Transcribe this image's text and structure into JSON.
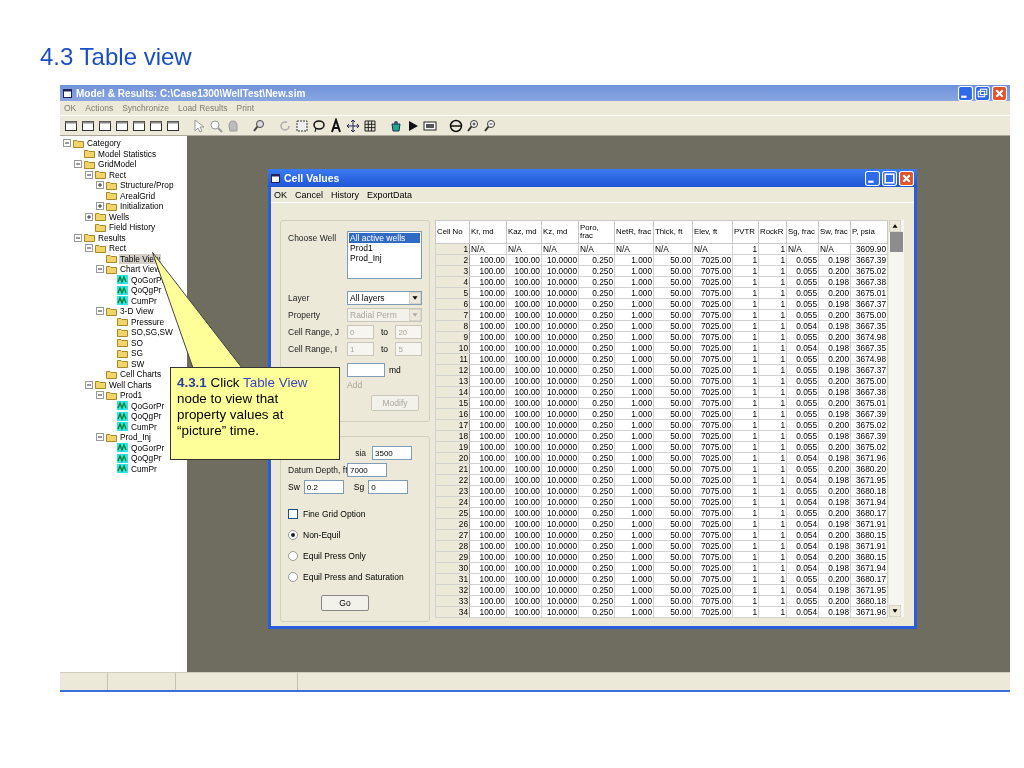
{
  "slide_title": "4.3 Table view",
  "window": {
    "title": "Model & Results:  C:\\Case1300\\WellTest\\New.sim"
  },
  "menu": [
    {
      "label": "OK",
      "disabled": true
    },
    {
      "label": "Actions",
      "disabled": true
    },
    {
      "label": "Synchronize",
      "disabled": true
    },
    {
      "label": "Load Results",
      "disabled": true
    },
    {
      "label": "Print",
      "disabled": true
    }
  ],
  "tree": [
    {
      "label": "Category",
      "kind": "folder",
      "expanded": true,
      "selected": false,
      "children": [
        {
          "label": "Model Statistics",
          "kind": "folder",
          "selected": false
        },
        {
          "label": "GridModel",
          "kind": "folder",
          "expanded": true,
          "selected": false,
          "children": [
            {
              "label": "Rect",
              "kind": "folder",
              "expanded": true,
              "selected": false,
              "children": [
                {
                  "label": "Structure/Prop",
                  "kind": "folder",
                  "expanded": false,
                  "selected": false
                },
                {
                  "label": "ArealGrid",
                  "kind": "folder",
                  "selected": false
                },
                {
                  "label": "Initialization",
                  "kind": "folder",
                  "expanded": false,
                  "selected": false
                }
              ]
            },
            {
              "label": "Wells",
              "kind": "folder",
              "expanded": false,
              "selected": false
            },
            {
              "label": "Field History",
              "kind": "folder",
              "selected": false
            }
          ]
        },
        {
          "label": "Results",
          "kind": "folder",
          "expanded": true,
          "selected": false,
          "children": [
            {
              "label": "Rect",
              "kind": "folder",
              "expanded": true,
              "selected": false,
              "children": [
                {
                  "label": "Table View",
                  "kind": "folder",
                  "selected": true
                },
                {
                  "label": "Chart View",
                  "kind": "folder",
                  "expanded": true,
                  "selected": false,
                  "children": [
                    {
                      "label": "QoGorPr",
                      "kind": "chart",
                      "selected": false
                    },
                    {
                      "label": "QoQgPr",
                      "kind": "chart",
                      "selected": false
                    },
                    {
                      "label": "CumPr",
                      "kind": "chart",
                      "selected": false
                    }
                  ]
                },
                {
                  "label": "3-D View",
                  "kind": "folder",
                  "expanded": true,
                  "selected": false,
                  "children": [
                    {
                      "label": "Pressure",
                      "kind": "folder",
                      "selected": false
                    },
                    {
                      "label": "SO,SG,SW",
                      "kind": "folder",
                      "selected": false
                    },
                    {
                      "label": "SO",
                      "kind": "folder",
                      "selected": false
                    },
                    {
                      "label": "SG",
                      "kind": "folder",
                      "selected": false
                    },
                    {
                      "label": "SW",
                      "kind": "folder",
                      "selected": false
                    }
                  ]
                },
                {
                  "label": "Cell Charts",
                  "kind": "folder",
                  "selected": false
                }
              ]
            },
            {
              "label": "Well Charts",
              "kind": "folder",
              "expanded": true,
              "selected": false,
              "children": [
                {
                  "label": "Prod1",
                  "kind": "folder",
                  "expanded": true,
                  "selected": false,
                  "children": [
                    {
                      "label": "QoGorPr",
                      "kind": "chart",
                      "selected": false
                    },
                    {
                      "label": "QoQgPr",
                      "kind": "chart",
                      "selected": false
                    },
                    {
                      "label": "CumPr",
                      "kind": "chart",
                      "selected": false
                    }
                  ]
                },
                {
                  "label": "Prod_Inj",
                  "kind": "folder",
                  "expanded": true,
                  "selected": false,
                  "children": [
                    {
                      "label": "QoGorPr",
                      "kind": "chart",
                      "selected": false
                    },
                    {
                      "label": "QoQgPr",
                      "kind": "chart",
                      "selected": false
                    },
                    {
                      "label": "CumPr",
                      "kind": "chart",
                      "selected": false
                    }
                  ]
                }
              ]
            }
          ]
        }
      ]
    }
  ],
  "dialog": {
    "title": "Cell Values",
    "menu": [
      "OK",
      "Cancel",
      "History",
      "ExportData"
    ],
    "choose_well": {
      "label": "Choose Well",
      "items": [
        {
          "label": "All active wells",
          "selected": true
        },
        {
          "label": "Prod1",
          "selected": false
        },
        {
          "label": "Prod_Inj",
          "selected": false
        }
      ]
    },
    "layer": {
      "label": "Layer",
      "value": "All layers",
      "disabled": false
    },
    "property": {
      "label": "Property",
      "value": "Radial Perm",
      "disabled": true
    },
    "cell_range_j": {
      "label": "Cell Range, J",
      "from": "0",
      "to_label": "to",
      "to": "20",
      "disabled": true
    },
    "cell_range_i": {
      "label": "Cell Range, I",
      "from": "1",
      "to_label": "to",
      "to": "5",
      "disabled": true
    },
    "new_value": {
      "unit": "md"
    },
    "add": {
      "label": "Add",
      "disabled": true
    },
    "modify_button": {
      "label": "Modify",
      "disabled": true
    },
    "initial_pressure": {
      "label": "sia",
      "value": "3500"
    },
    "datum_depth": {
      "label": "Datum Depth, ft",
      "value": "7000"
    },
    "sw": {
      "label": "Sw",
      "value": "0.2"
    },
    "sg": {
      "label": "Sg",
      "value": "0"
    },
    "fine_grid": {
      "label": "Fine Grid Option",
      "checked": false
    },
    "init_modes": [
      {
        "label": "Non-Equil",
        "selected": true
      },
      {
        "label": "Equil Press Only",
        "selected": false
      },
      {
        "label": "Equil Press and Saturation",
        "selected": false
      }
    ],
    "go_button": "Go",
    "table": {
      "columns": [
        "Cell No",
        "Kr, md",
        "Kaz, md",
        "Kz, md",
        "Poro, frac",
        "NetR, frac",
        "Thick, ft",
        "Elev, ft",
        "PVTR",
        "RockR",
        "Sg, frac",
        "Sw, frac",
        "P, psia"
      ],
      "rows": [
        [
          "1",
          "N/A",
          "N/A",
          "N/A",
          "N/A",
          "N/A",
          "N/A",
          "N/A",
          "1",
          "1",
          "N/A",
          "N/A",
          "3609.90"
        ],
        [
          "2",
          "100.00",
          "100.00",
          "10.0000",
          "0.250",
          "1.000",
          "50.00",
          "7025.00",
          "1",
          "1",
          "0.055",
          "0.198",
          "3667.39"
        ],
        [
          "3",
          "100.00",
          "100.00",
          "10.0000",
          "0.250",
          "1.000",
          "50.00",
          "7075.00",
          "1",
          "1",
          "0.055",
          "0.200",
          "3675.02"
        ],
        [
          "4",
          "100.00",
          "100.00",
          "10.0000",
          "0.250",
          "1.000",
          "50.00",
          "7025.00",
          "1",
          "1",
          "0.055",
          "0.198",
          "3667.38"
        ],
        [
          "5",
          "100.00",
          "100.00",
          "10.0000",
          "0.250",
          "1.000",
          "50.00",
          "7075.00",
          "1",
          "1",
          "0.055",
          "0.200",
          "3675.01"
        ],
        [
          "6",
          "100.00",
          "100.00",
          "10.0000",
          "0.250",
          "1.000",
          "50.00",
          "7025.00",
          "1",
          "1",
          "0.055",
          "0.198",
          "3667.37"
        ],
        [
          "7",
          "100.00",
          "100.00",
          "10.0000",
          "0.250",
          "1.000",
          "50.00",
          "7075.00",
          "1",
          "1",
          "0.055",
          "0.200",
          "3675.00"
        ],
        [
          "8",
          "100.00",
          "100.00",
          "10.0000",
          "0.250",
          "1.000",
          "50.00",
          "7025.00",
          "1",
          "1",
          "0.054",
          "0.198",
          "3667.35"
        ],
        [
          "9",
          "100.00",
          "100.00",
          "10.0000",
          "0.250",
          "1.000",
          "50.00",
          "7075.00",
          "1",
          "1",
          "0.055",
          "0.200",
          "3674.98"
        ],
        [
          "10",
          "100.00",
          "100.00",
          "10.0000",
          "0.250",
          "1.000",
          "50.00",
          "7025.00",
          "1",
          "1",
          "0.054",
          "0.198",
          "3667.35"
        ],
        [
          "11",
          "100.00",
          "100.00",
          "10.0000",
          "0.250",
          "1.000",
          "50.00",
          "7075.00",
          "1",
          "1",
          "0.055",
          "0.200",
          "3674.98"
        ],
        [
          "12",
          "100.00",
          "100.00",
          "10.0000",
          "0.250",
          "1.000",
          "50.00",
          "7025.00",
          "1",
          "1",
          "0.055",
          "0.198",
          "3667.37"
        ],
        [
          "13",
          "100.00",
          "100.00",
          "10.0000",
          "0.250",
          "1.000",
          "50.00",
          "7075.00",
          "1",
          "1",
          "0.055",
          "0.200",
          "3675.00"
        ],
        [
          "14",
          "100.00",
          "100.00",
          "10.0000",
          "0.250",
          "1.000",
          "50.00",
          "7025.00",
          "1",
          "1",
          "0.055",
          "0.198",
          "3667.38"
        ],
        [
          "15",
          "100.00",
          "100.00",
          "10.0000",
          "0.250",
          "1.000",
          "50.00",
          "7075.00",
          "1",
          "1",
          "0.055",
          "0.200",
          "3675.01"
        ],
        [
          "16",
          "100.00",
          "100.00",
          "10.0000",
          "0.250",
          "1.000",
          "50.00",
          "7025.00",
          "1",
          "1",
          "0.055",
          "0.198",
          "3667.39"
        ],
        [
          "17",
          "100.00",
          "100.00",
          "10.0000",
          "0.250",
          "1.000",
          "50.00",
          "7075.00",
          "1",
          "1",
          "0.055",
          "0.200",
          "3675.02"
        ],
        [
          "18",
          "100.00",
          "100.00",
          "10.0000",
          "0.250",
          "1.000",
          "50.00",
          "7025.00",
          "1",
          "1",
          "0.055",
          "0.198",
          "3667.39"
        ],
        [
          "19",
          "100.00",
          "100.00",
          "10.0000",
          "0.250",
          "1.000",
          "50.00",
          "7075.00",
          "1",
          "1",
          "0.055",
          "0.200",
          "3675.02"
        ],
        [
          "20",
          "100.00",
          "100.00",
          "10.0000",
          "0.250",
          "1.000",
          "50.00",
          "7025.00",
          "1",
          "1",
          "0.054",
          "0.198",
          "3671.96"
        ],
        [
          "21",
          "100.00",
          "100.00",
          "10.0000",
          "0.250",
          "1.000",
          "50.00",
          "7075.00",
          "1",
          "1",
          "0.055",
          "0.200",
          "3680.20"
        ],
        [
          "22",
          "100.00",
          "100.00",
          "10.0000",
          "0.250",
          "1.000",
          "50.00",
          "7025.00",
          "1",
          "1",
          "0.054",
          "0.198",
          "3671.95"
        ],
        [
          "23",
          "100.00",
          "100.00",
          "10.0000",
          "0.250",
          "1.000",
          "50.00",
          "7075.00",
          "1",
          "1",
          "0.055",
          "0.200",
          "3680.18"
        ],
        [
          "24",
          "100.00",
          "100.00",
          "10.0000",
          "0.250",
          "1.000",
          "50.00",
          "7025.00",
          "1",
          "1",
          "0.054",
          "0.198",
          "3671.94"
        ],
        [
          "25",
          "100.00",
          "100.00",
          "10.0000",
          "0.250",
          "1.000",
          "50.00",
          "7075.00",
          "1",
          "1",
          "0.055",
          "0.200",
          "3680.17"
        ],
        [
          "26",
          "100.00",
          "100.00",
          "10.0000",
          "0.250",
          "1.000",
          "50.00",
          "7025.00",
          "1",
          "1",
          "0.054",
          "0.198",
          "3671.91"
        ],
        [
          "27",
          "100.00",
          "100.00",
          "10.0000",
          "0.250",
          "1.000",
          "50.00",
          "7075.00",
          "1",
          "1",
          "0.054",
          "0.200",
          "3680.15"
        ],
        [
          "28",
          "100.00",
          "100.00",
          "10.0000",
          "0.250",
          "1.000",
          "50.00",
          "7025.00",
          "1",
          "1",
          "0.054",
          "0.198",
          "3671.91"
        ],
        [
          "29",
          "100.00",
          "100.00",
          "10.0000",
          "0.250",
          "1.000",
          "50.00",
          "7075.00",
          "1",
          "1",
          "0.054",
          "0.200",
          "3680.15"
        ],
        [
          "30",
          "100.00",
          "100.00",
          "10.0000",
          "0.250",
          "1.000",
          "50.00",
          "7025.00",
          "1",
          "1",
          "0.054",
          "0.198",
          "3671.94"
        ],
        [
          "31",
          "100.00",
          "100.00",
          "10.0000",
          "0.250",
          "1.000",
          "50.00",
          "7075.00",
          "1",
          "1",
          "0.055",
          "0.200",
          "3680.17"
        ],
        [
          "32",
          "100.00",
          "100.00",
          "10.0000",
          "0.250",
          "1.000",
          "50.00",
          "7025.00",
          "1",
          "1",
          "0.054",
          "0.198",
          "3671.95"
        ],
        [
          "33",
          "100.00",
          "100.00",
          "10.0000",
          "0.250",
          "1.000",
          "50.00",
          "7075.00",
          "1",
          "1",
          "0.055",
          "0.200",
          "3680.18"
        ],
        [
          "34",
          "100.00",
          "100.00",
          "10.0000",
          "0.250",
          "1.000",
          "50.00",
          "7025.00",
          "1",
          "1",
          "0.054",
          "0.198",
          "3671.96"
        ]
      ]
    }
  },
  "callout": {
    "number": "4.3.1",
    "before": "Click",
    "highlight": "Table View",
    "after": "node to view that property values at “picture” time."
  }
}
